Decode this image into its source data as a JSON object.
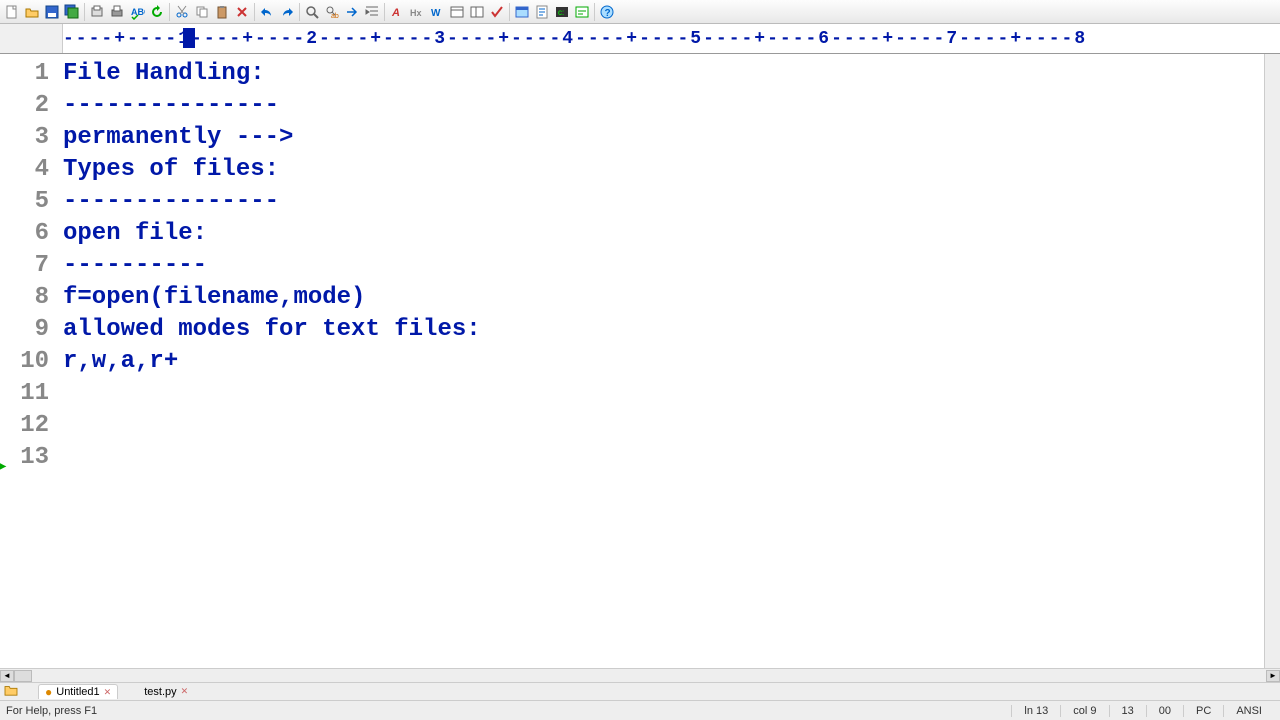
{
  "toolbar_icons": [
    "new-file-icon",
    "open-icon",
    "save-icon",
    "save-all-icon",
    "sep",
    "print-preview-icon",
    "print-icon",
    "spell-icon",
    "refresh-icon",
    "sep",
    "cut-icon",
    "copy-icon",
    "paste-icon",
    "delete-icon",
    "sep",
    "undo-icon",
    "redo-icon",
    "sep",
    "find-icon",
    "find-text-icon",
    "goto-icon",
    "indent-icon",
    "sep",
    "highlight-icon",
    "hex-icon",
    "word-icon",
    "panel-icon",
    "panel2-icon",
    "check-icon",
    "sep",
    "window-icon",
    "script-icon",
    "terminal-icon",
    "output-icon",
    "sep",
    "help-icon"
  ],
  "ruler": {
    "text": "----+----1----+----2----+----3----+----4----+----5----+----6----+----7----+----8"
  },
  "lines": [
    "File Handling:",
    "---------------",
    "permanently --->",
    "Types of files:",
    "---------------",
    "",
    "",
    "open file:",
    "----------",
    "f=open(filename,mode)",
    "",
    "allowed modes for text files:",
    "r,w,a,r+"
  ],
  "current_line": 13,
  "tabs": [
    {
      "label": "Untitled1",
      "modified": true,
      "active": true
    },
    {
      "label": "test.py",
      "modified": false,
      "active": false
    }
  ],
  "status": {
    "help": "For Help, press F1",
    "line": "ln 13",
    "col": "col 9",
    "lines_total": "13",
    "sel": "00",
    "platform": "PC",
    "encoding": "ANSI"
  }
}
